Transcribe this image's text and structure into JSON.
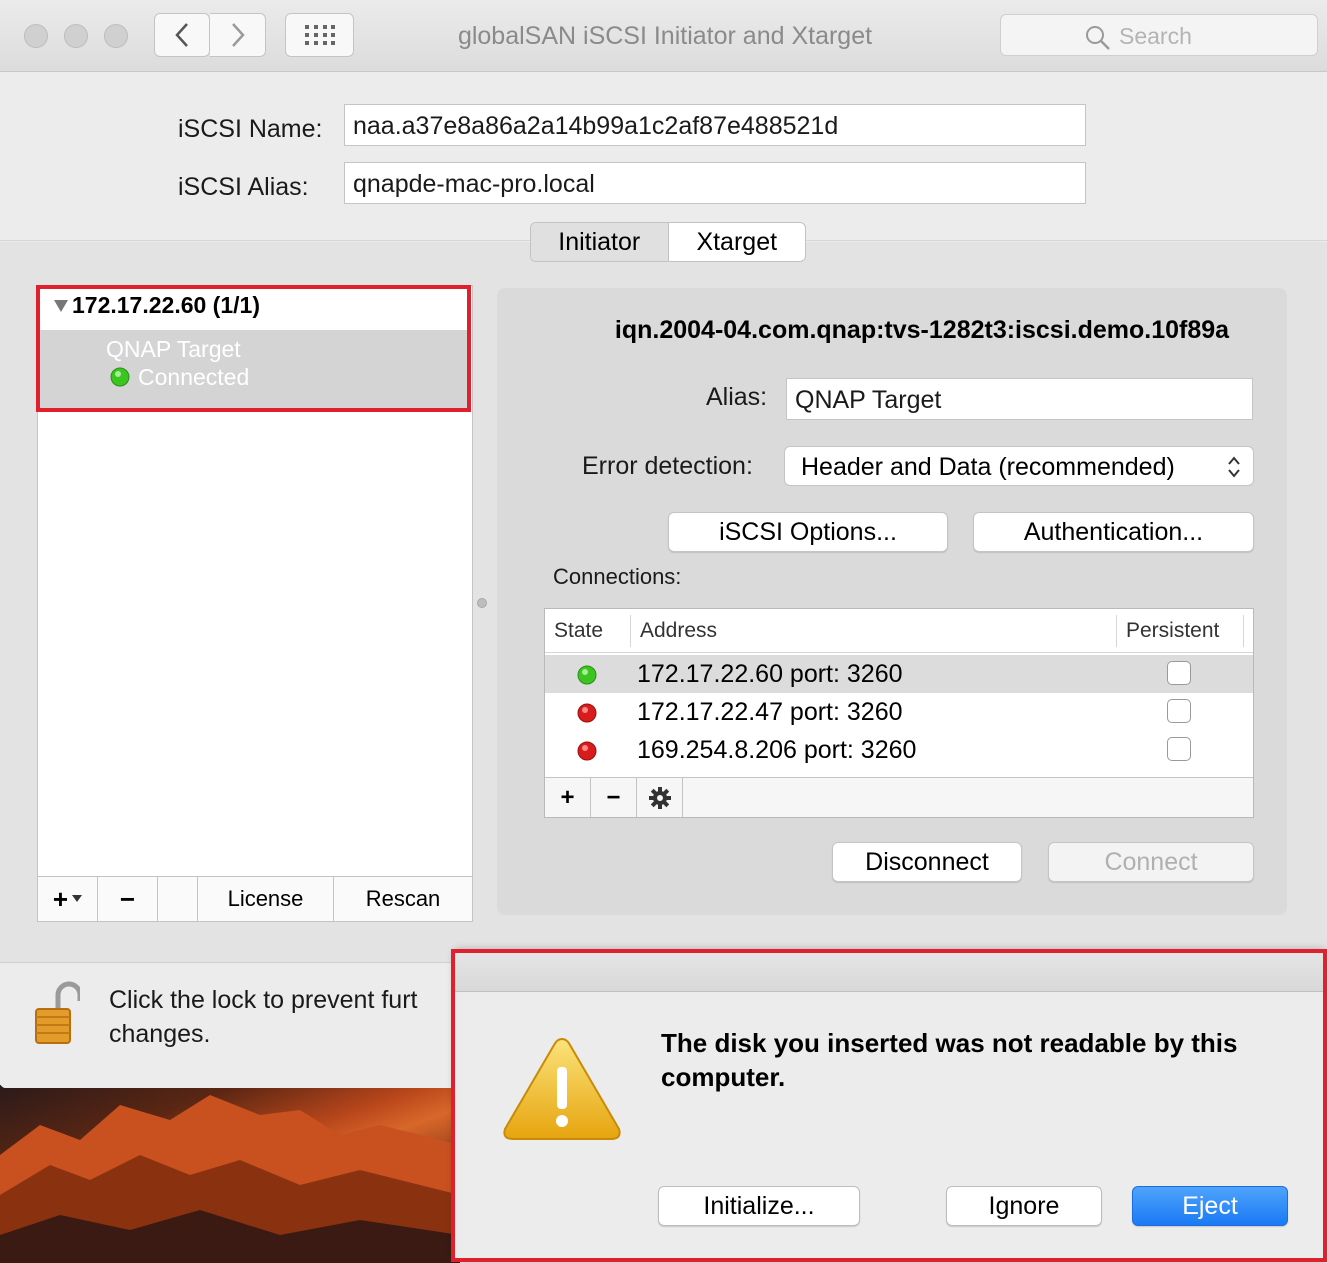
{
  "window": {
    "title": "globalSAN iSCSI Initiator and Xtarget",
    "search_placeholder": "Search"
  },
  "identity": {
    "name_label": "iSCSI Name:",
    "name_value": "naa.a37e8a86a2a14b99a1c2af87e488521d",
    "alias_label": "iSCSI Alias:",
    "alias_value": "qnapde-mac-pro.local"
  },
  "tabs": [
    {
      "label": "Initiator",
      "selected": true
    },
    {
      "label": "Xtarget",
      "selected": false
    }
  ],
  "tree": {
    "portal": "172.17.22.60 (1/1)",
    "target_name": "QNAP Target",
    "target_status": "Connected",
    "target_status_color": "#3cc421",
    "buttons": {
      "add": "+",
      "remove": "−",
      "license": "License",
      "rescan": "Rescan"
    }
  },
  "detail": {
    "iqn": "iqn.2004-04.com.qnap:tvs-1282t3:iscsi.demo.10f89a",
    "alias_label": "Alias:",
    "alias_value": "QNAP Target",
    "error_label": "Error detection:",
    "error_value": "Header and Data (recommended)",
    "options_button": "iSCSI Options...",
    "auth_button": "Authentication...",
    "connections_label": "Connections:",
    "columns": {
      "state": "State",
      "address": "Address",
      "persistent": "Persistent"
    },
    "connections": [
      {
        "state": "green",
        "address": "172.17.22.60 port: 3260",
        "persistent": false
      },
      {
        "state": "red",
        "address": "172.17.22.47 port: 3260",
        "persistent": false
      },
      {
        "state": "red",
        "address": "169.254.8.206 port: 3260",
        "persistent": false
      }
    ],
    "disconnect_button": "Disconnect",
    "connect_button": "Connect"
  },
  "lock": {
    "text_line1": "Click the lock to prevent furt",
    "text_line2": "changes."
  },
  "dialog": {
    "message": "The disk you inserted was not readable by this computer.",
    "initialize_button": "Initialize...",
    "ignore_button": "Ignore",
    "eject_button": "Eject"
  },
  "colors": {
    "highlight": "#e0202c",
    "led_green": "#3cc421",
    "led_red": "#d81b1b",
    "primary_button": "#1a7af5"
  }
}
